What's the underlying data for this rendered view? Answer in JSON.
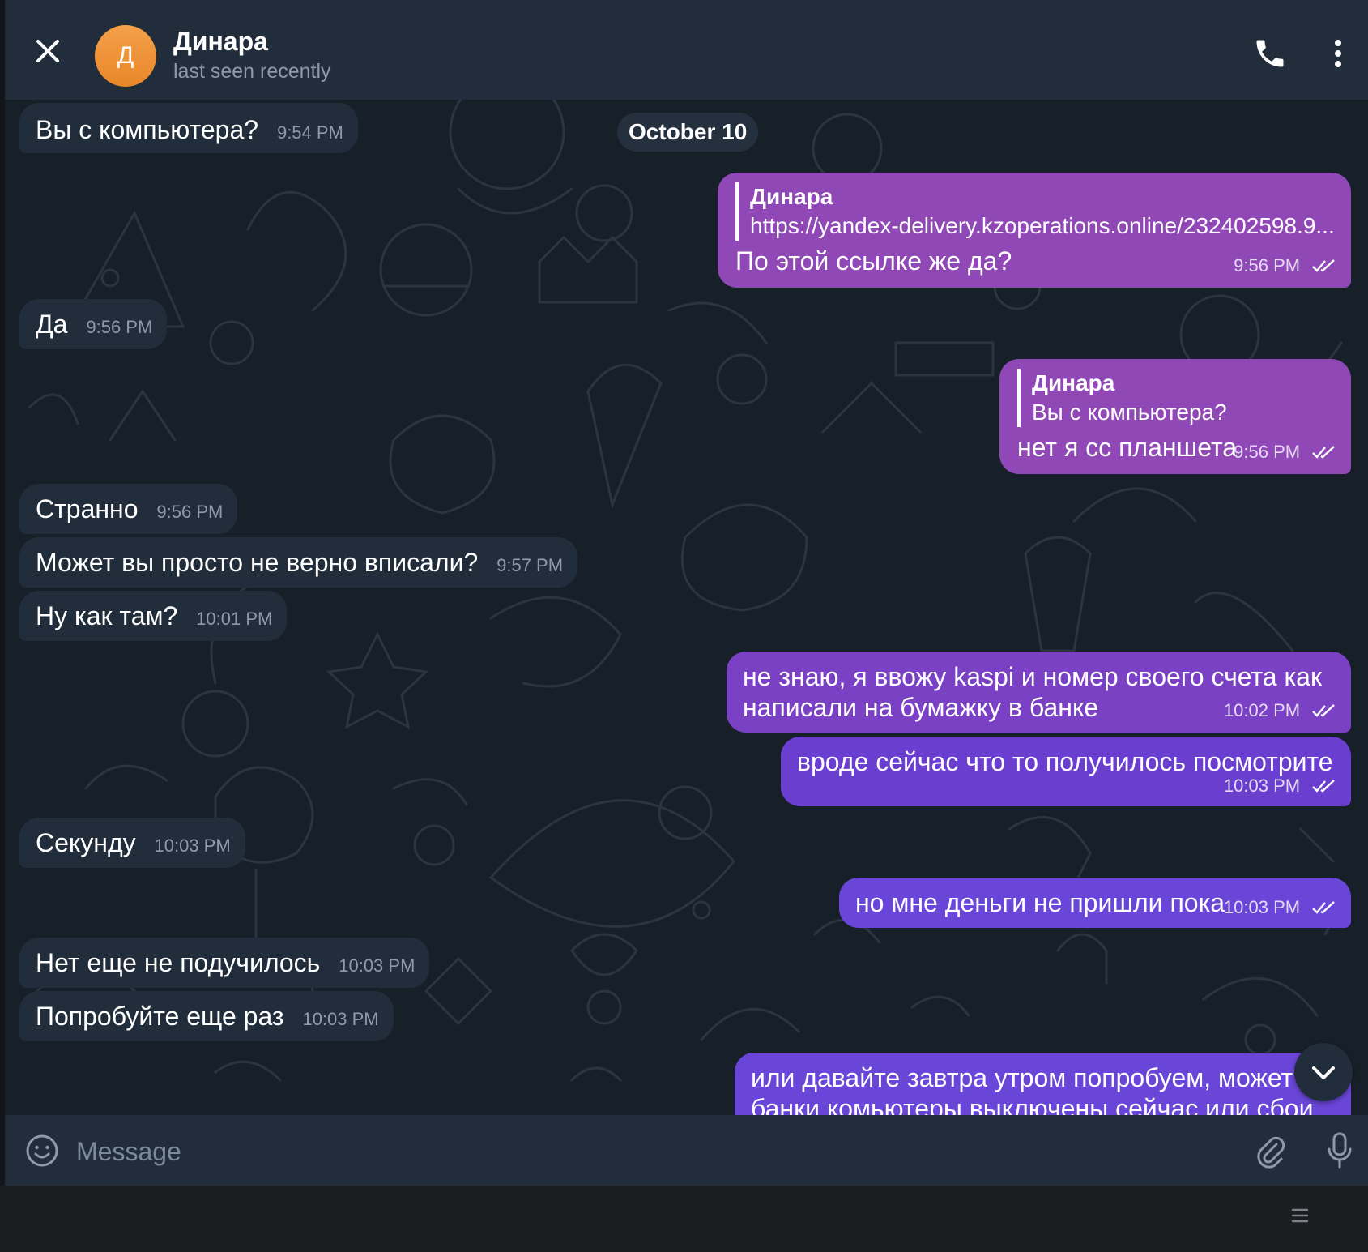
{
  "header": {
    "avatar_letter": "Д",
    "name": "Динара",
    "status": "last seen recently"
  },
  "chat": {
    "date_separator": "October 10",
    "messages": [
      {
        "dir": "in",
        "text": "Вы с компьютера?",
        "time": "9:54 PM"
      },
      {
        "dir": "out",
        "reply_name": "Динара",
        "reply_text": "https://yandex-delivery.kzoperations.online/232402598.9...",
        "text": "По этой ссылке же да?",
        "time": "9:56 PM"
      },
      {
        "dir": "in",
        "text": "Да",
        "time": "9:56 PM"
      },
      {
        "dir": "out",
        "reply_name": "Динара",
        "reply_text": "Вы с компьютера?",
        "text": "нет я сс планшета",
        "time": "9:56 PM"
      },
      {
        "dir": "in",
        "text": "Странно",
        "time": "9:56 PM"
      },
      {
        "dir": "in",
        "text": "Может вы просто не верно вписали?",
        "time": "9:57 PM"
      },
      {
        "dir": "in",
        "text": "Ну как там?",
        "time": "10:01 PM"
      },
      {
        "dir": "out",
        "text_line1": "не знаю, я ввожу kaspi и номер своего счета как",
        "text_line2": "написали на бумажку в банке",
        "time": "10:02 PM"
      },
      {
        "dir": "out",
        "text": "вроде сейчас что то получилось посмотрите",
        "time": "10:03 PM"
      },
      {
        "dir": "in",
        "text": "Секунду",
        "time": "10:03 PM"
      },
      {
        "dir": "out",
        "text": "но мне деньги не пришли пока",
        "time": "10:03 PM"
      },
      {
        "dir": "in",
        "text": "Нет еще не подучилось",
        "time": "10:03 PM"
      },
      {
        "dir": "in",
        "text": "Попробуйте еще раз",
        "time": "10:03 PM"
      },
      {
        "dir": "out",
        "text_line1": "или давайте завтра утром попробуем, может",
        "text_line2": "банки комьютеры выключены сейчас или сбои"
      }
    ]
  },
  "composer": {
    "placeholder": "Message"
  },
  "icons": {
    "close": "close-icon",
    "phone": "phone-icon",
    "menu": "more-vertical-icon",
    "emoji": "emoji-icon",
    "attach": "paperclip-icon",
    "mic": "microphone-icon",
    "scroll": "chevron-down-icon",
    "read": "double-check-icon"
  },
  "colors": {
    "header_bg": "#212d3b",
    "chat_bg": "#172029",
    "incoming_bubble": "#212d3b",
    "outgoing_bubble_top": "#8f48b5",
    "outgoing_bubble_bottom": "#6a46d8",
    "avatar": "#f0962e"
  }
}
